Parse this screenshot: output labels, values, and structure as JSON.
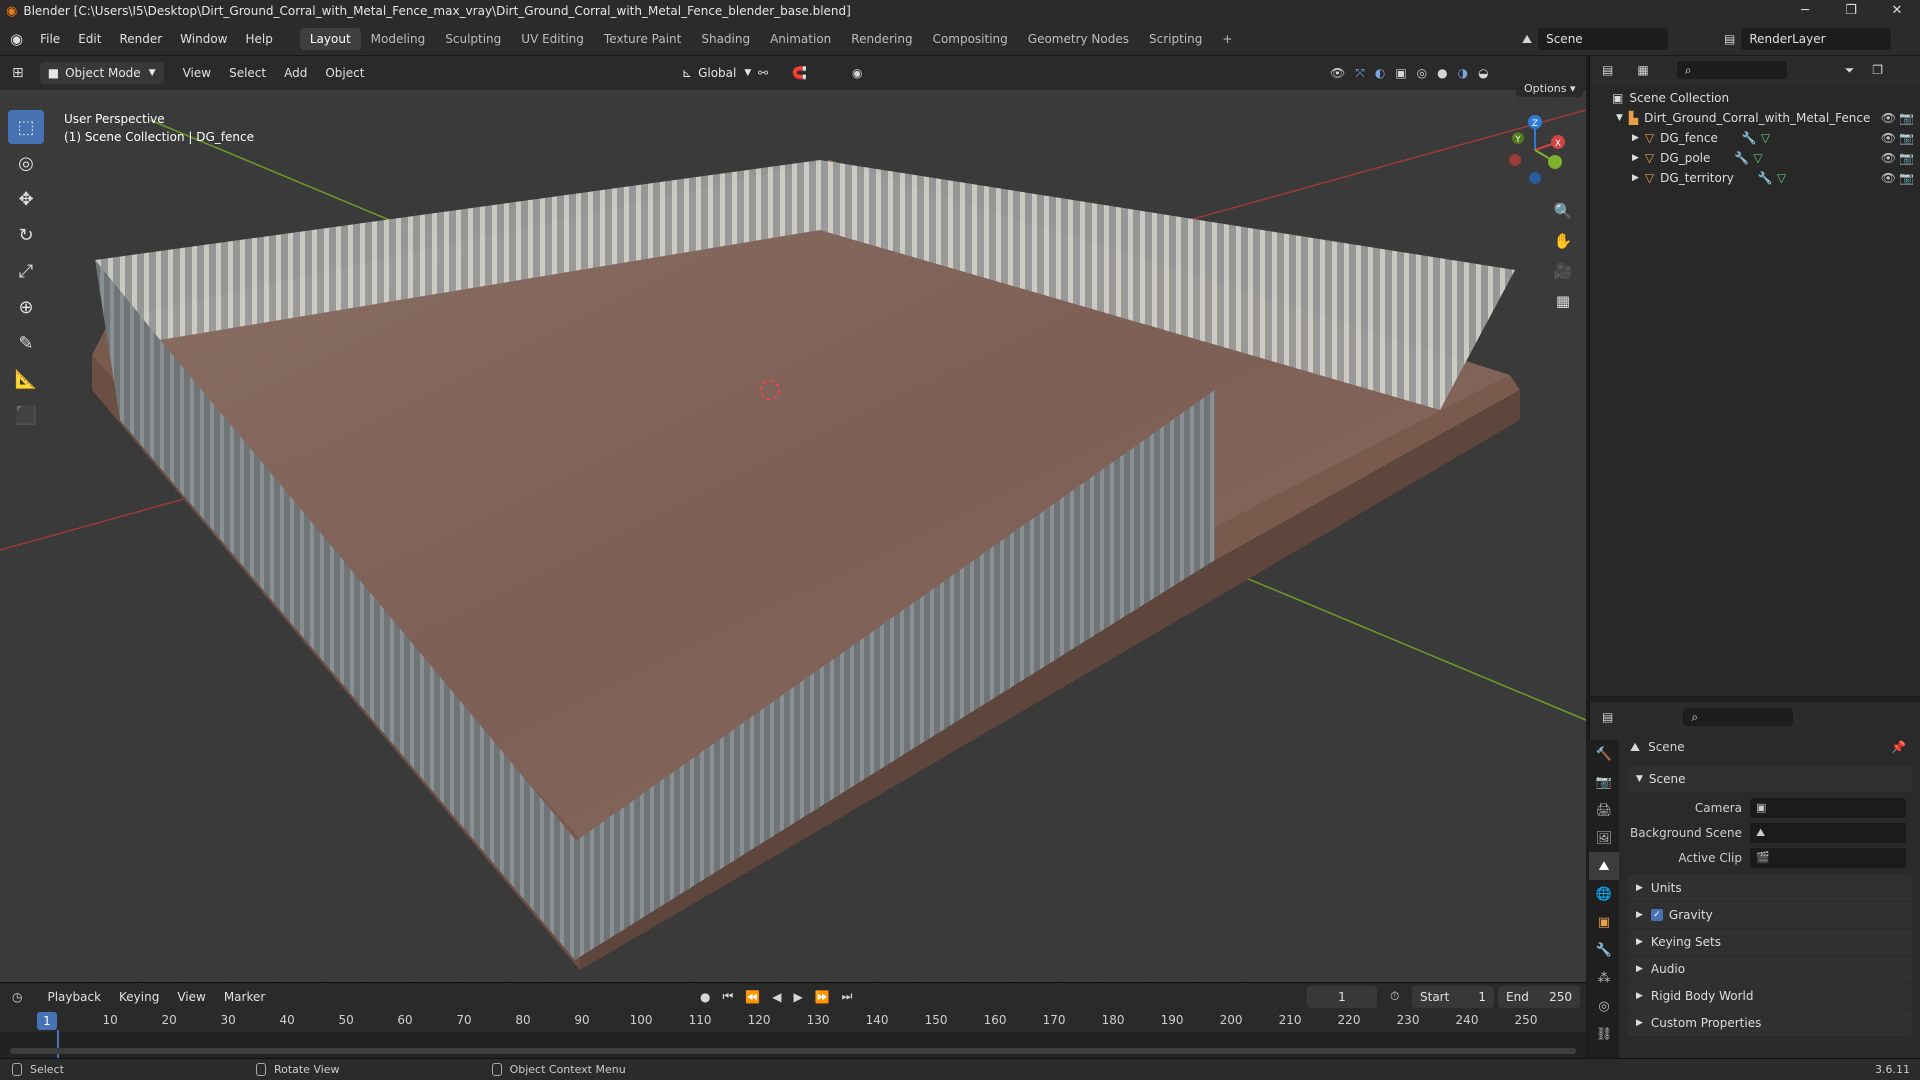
{
  "titlebar": {
    "title": "Blender [C:\\Users\\I5\\Desktop\\Dirt_Ground_Corral_with_Metal_Fence_max_vray\\Dirt_Ground_Corral_with_Metal_Fence_blender_base.blend]"
  },
  "menu": [
    "File",
    "Edit",
    "Render",
    "Window",
    "Help"
  ],
  "workspaces": [
    "Layout",
    "Modeling",
    "Sculpting",
    "UV Editing",
    "Texture Paint",
    "Shading",
    "Animation",
    "Rendering",
    "Compositing",
    "Geometry Nodes",
    "Scripting"
  ],
  "active_workspace": "Layout",
  "scene_field": "Scene",
  "renderlayer_field": "RenderLayer",
  "viewport_header": {
    "mode": "Object Mode",
    "menus": [
      "View",
      "Select",
      "Add",
      "Object"
    ],
    "orientation": "Global",
    "options": "Options"
  },
  "viewport_info": {
    "line1": "User Perspective",
    "line2": "(1) Scene Collection | DG_fence"
  },
  "gizmo": {
    "z": "Z",
    "y": "Y",
    "x": "X"
  },
  "outliner": {
    "root": "Scene Collection",
    "collection": "Dirt_Ground_Corral_with_Metal_Fence",
    "objects": [
      "DG_fence",
      "DG_pole",
      "DG_territory"
    ]
  },
  "properties": {
    "header": "Scene",
    "panel": "Scene",
    "rows": [
      {
        "label": "Camera",
        "value": ""
      },
      {
        "label": "Background Scene",
        "value": ""
      },
      {
        "label": "Active Clip",
        "value": ""
      }
    ],
    "sections": [
      "Units",
      "Gravity",
      "Keying Sets",
      "Audio",
      "Rigid Body World",
      "Custom Properties"
    ],
    "gravity_checked": true
  },
  "timeline": {
    "menus": [
      "Playback",
      "Keying",
      "View",
      "Marker"
    ],
    "current_frame": "1",
    "start_label": "Start",
    "start": "1",
    "end_label": "End",
    "end": "250",
    "ticks": [
      "10",
      "20",
      "30",
      "40",
      "50",
      "60",
      "70",
      "80",
      "90",
      "100",
      "110",
      "120",
      "130",
      "140",
      "150",
      "160",
      "170",
      "180",
      "190",
      "200",
      "210",
      "220",
      "230",
      "240",
      "250"
    ],
    "current_tick": "1"
  },
  "statusbar": {
    "items": [
      "Select",
      "Rotate View",
      "Object Context Menu"
    ],
    "version": "3.6.11"
  },
  "colors": {
    "accent": "#4772b3",
    "x_axis": "#d14444",
    "y_axis": "#7db12b",
    "z_axis": "#2e7bd6",
    "fence": "#7a7f82",
    "dirt": "#8a6a5c"
  }
}
